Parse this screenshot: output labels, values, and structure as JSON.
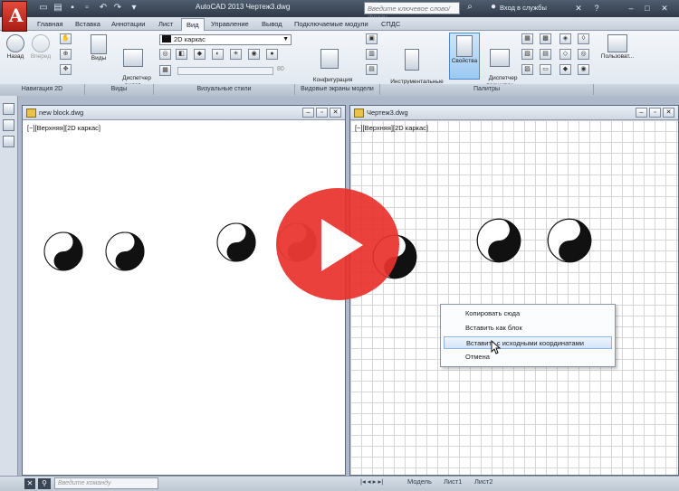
{
  "window": {
    "title": "AutoCAD 2013   Чертеж3.dwg",
    "search_placeholder": "Введите ключевое слово/фразу",
    "signin": "Вход в службы"
  },
  "ribbon_tabs": [
    "Главная",
    "Вставка",
    "Аннотации",
    "Лист",
    "Вид",
    "Управление",
    "Вывод",
    "Подключаемые модули",
    "СПДС"
  ],
  "active_tab": "Вид",
  "ribbon": {
    "nav_back": "Назад",
    "nav_forward": "Вперед",
    "views": "Виды",
    "view_manager": "Диспетчер\nвидов",
    "visual_style": "2D каркас",
    "slider_value": "80",
    "viewport_config": "Конфигурация\nвидового экрана",
    "tool_palettes": "Инструментальные\nпалитры",
    "properties": "Свойства",
    "sheet_set": "Диспетчер\nподшивок",
    "user_interface": "Пользоват...",
    "panels": [
      "Навигация 2D",
      "Виды",
      "Визуальные стили",
      "Видовые экраны модели",
      "Палитры"
    ]
  },
  "documents": [
    {
      "title": "new block.dwg",
      "viewport_label": "[−][Верхняя][2D каркас]"
    },
    {
      "title": "Чертеж3.dwg",
      "viewport_label": "[−][Верхняя][2D каркас]"
    }
  ],
  "context_menu": {
    "items": [
      "Копировать сюда",
      "Вставить как блок",
      "Вставить с исходными координатами",
      "Отмена"
    ],
    "highlighted_index": 2
  },
  "statusbar": {
    "command_placeholder": "Введите команду",
    "layout_tabs": [
      "Модель",
      "Лист1",
      "Лист2"
    ]
  },
  "colors": {
    "play_button": "#e8312b",
    "accent": "#4a8ad0"
  }
}
